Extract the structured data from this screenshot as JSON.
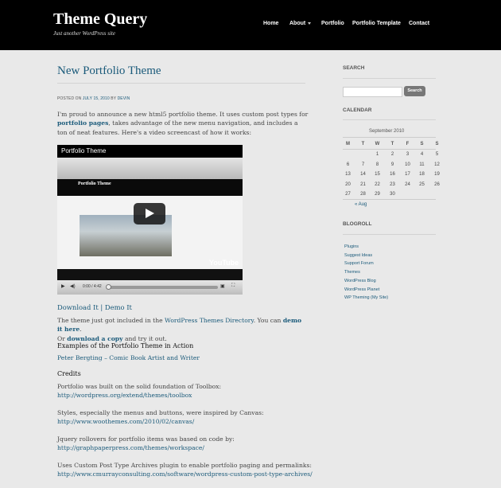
{
  "header": {
    "site_title": "Theme Query",
    "site_description": "Just another WordPress site",
    "nav": [
      {
        "label": "Home"
      },
      {
        "label": "About",
        "has_submenu": true
      },
      {
        "label": "Portfolio"
      },
      {
        "label": "Portfolio Template"
      },
      {
        "label": "Contact"
      }
    ]
  },
  "post": {
    "title": "New Portfolio Theme",
    "meta_prefix": "Posted on",
    "meta_date": "July 15, 2010",
    "meta_by": "by",
    "meta_author": "devin",
    "intro_1": "I'm proud to announce a new html5 portfolio theme. It uses custom post types for",
    "intro_link": "portfolio pages",
    "intro_2": ", takes advantage of the new menu navigation, and includes a ton of neat",
    "intro_3": "features. Here's a video screencast of how it works:",
    "video": {
      "title": "Portfolio Theme",
      "inner_site_title": "Portfolio Theme",
      "time": "0:00 / 4:42",
      "brand": "YouTube"
    },
    "download_label": "Download It",
    "separator": "|",
    "demo_label": "Demo It",
    "included_1": "The theme just got included in the",
    "included_link": "WordPress Themes Directory",
    "included_2": ". You can",
    "demo_here": "demo it here",
    "included_3": ".",
    "or_text": "Or",
    "download_copy": "download a copy",
    "try_text": "and try it out.",
    "examples_heading": "Examples of the Portfolio Theme in Action",
    "example_link": "Peter Bergting – Comic Book Artist and Writer",
    "credits_heading": "Credits",
    "credits": [
      {
        "text": "Portfolio was built on the solid foundation of Toolbox:",
        "url": "http://wordpress.org/extend/themes/toolbox"
      },
      {
        "text": "Styles, especially the menus and buttons, were inspired by Canvas:",
        "url": "http://www.woothemes.com/2010/02/canvas/"
      },
      {
        "text": "Jquery rollovers for portfolio items was based on code by:",
        "url": "http://graphpaperpress.com/themes/workspace/"
      },
      {
        "text": "Uses Custom Post Type Archives plugin to enable portfolio paging and permalinks:",
        "url": "http://www.cmurrayconsulting.com/software/wordpress-custom-post-type-archives/"
      }
    ]
  },
  "sidebar": {
    "search_heading": "SEARCH",
    "search_placeholder": "",
    "search_button": "Search",
    "calendar_heading": "CALENDAR",
    "calendar_caption": "September 2010",
    "weekdays": [
      "M",
      "T",
      "W",
      "T",
      "F",
      "S",
      "S"
    ],
    "weeks": [
      [
        "",
        "",
        "1",
        "2",
        "3",
        "4",
        "5"
      ],
      [
        "6",
        "7",
        "8",
        "9",
        "10",
        "11",
        "12"
      ],
      [
        "13",
        "14",
        "15",
        "16",
        "17",
        "18",
        "19"
      ],
      [
        "20",
        "21",
        "22",
        "23",
        "24",
        "25",
        "26"
      ],
      [
        "27",
        "28",
        "29",
        "30",
        "",
        "",
        ""
      ]
    ],
    "prev_month": "« Aug",
    "blogroll_heading": "BLOGROLL",
    "blogroll": [
      "Plugins",
      "Suggest Ideas",
      "Support Forum",
      "Themes",
      "WordPress Blog",
      "WordPress Planet",
      "WP Theming (My Site)"
    ]
  }
}
